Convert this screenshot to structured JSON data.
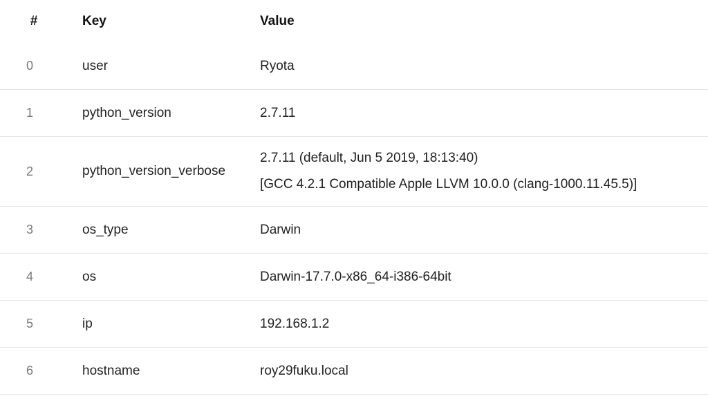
{
  "table": {
    "columns": {
      "index": "#",
      "key": "Key",
      "value": "Value"
    },
    "rows": [
      {
        "index": "0",
        "key": "user",
        "value": [
          "Ryota"
        ]
      },
      {
        "index": "1",
        "key": "python_version",
        "value": [
          "2.7.11"
        ]
      },
      {
        "index": "2",
        "key": "python_version_verbose",
        "value": [
          "2.7.11 (default, Jun 5 2019, 18:13:40)",
          "[GCC 4.2.1 Compatible Apple LLVM 10.0.0 (clang-1000.11.45.5)]"
        ]
      },
      {
        "index": "3",
        "key": "os_type",
        "value": [
          "Darwin"
        ]
      },
      {
        "index": "4",
        "key": "os",
        "value": [
          "Darwin-17.7.0-x86_64-i386-64bit"
        ]
      },
      {
        "index": "5",
        "key": "ip",
        "value": [
          "192.168.1.2"
        ]
      },
      {
        "index": "6",
        "key": "hostname",
        "value": [
          "roy29fuku.local"
        ]
      }
    ]
  }
}
